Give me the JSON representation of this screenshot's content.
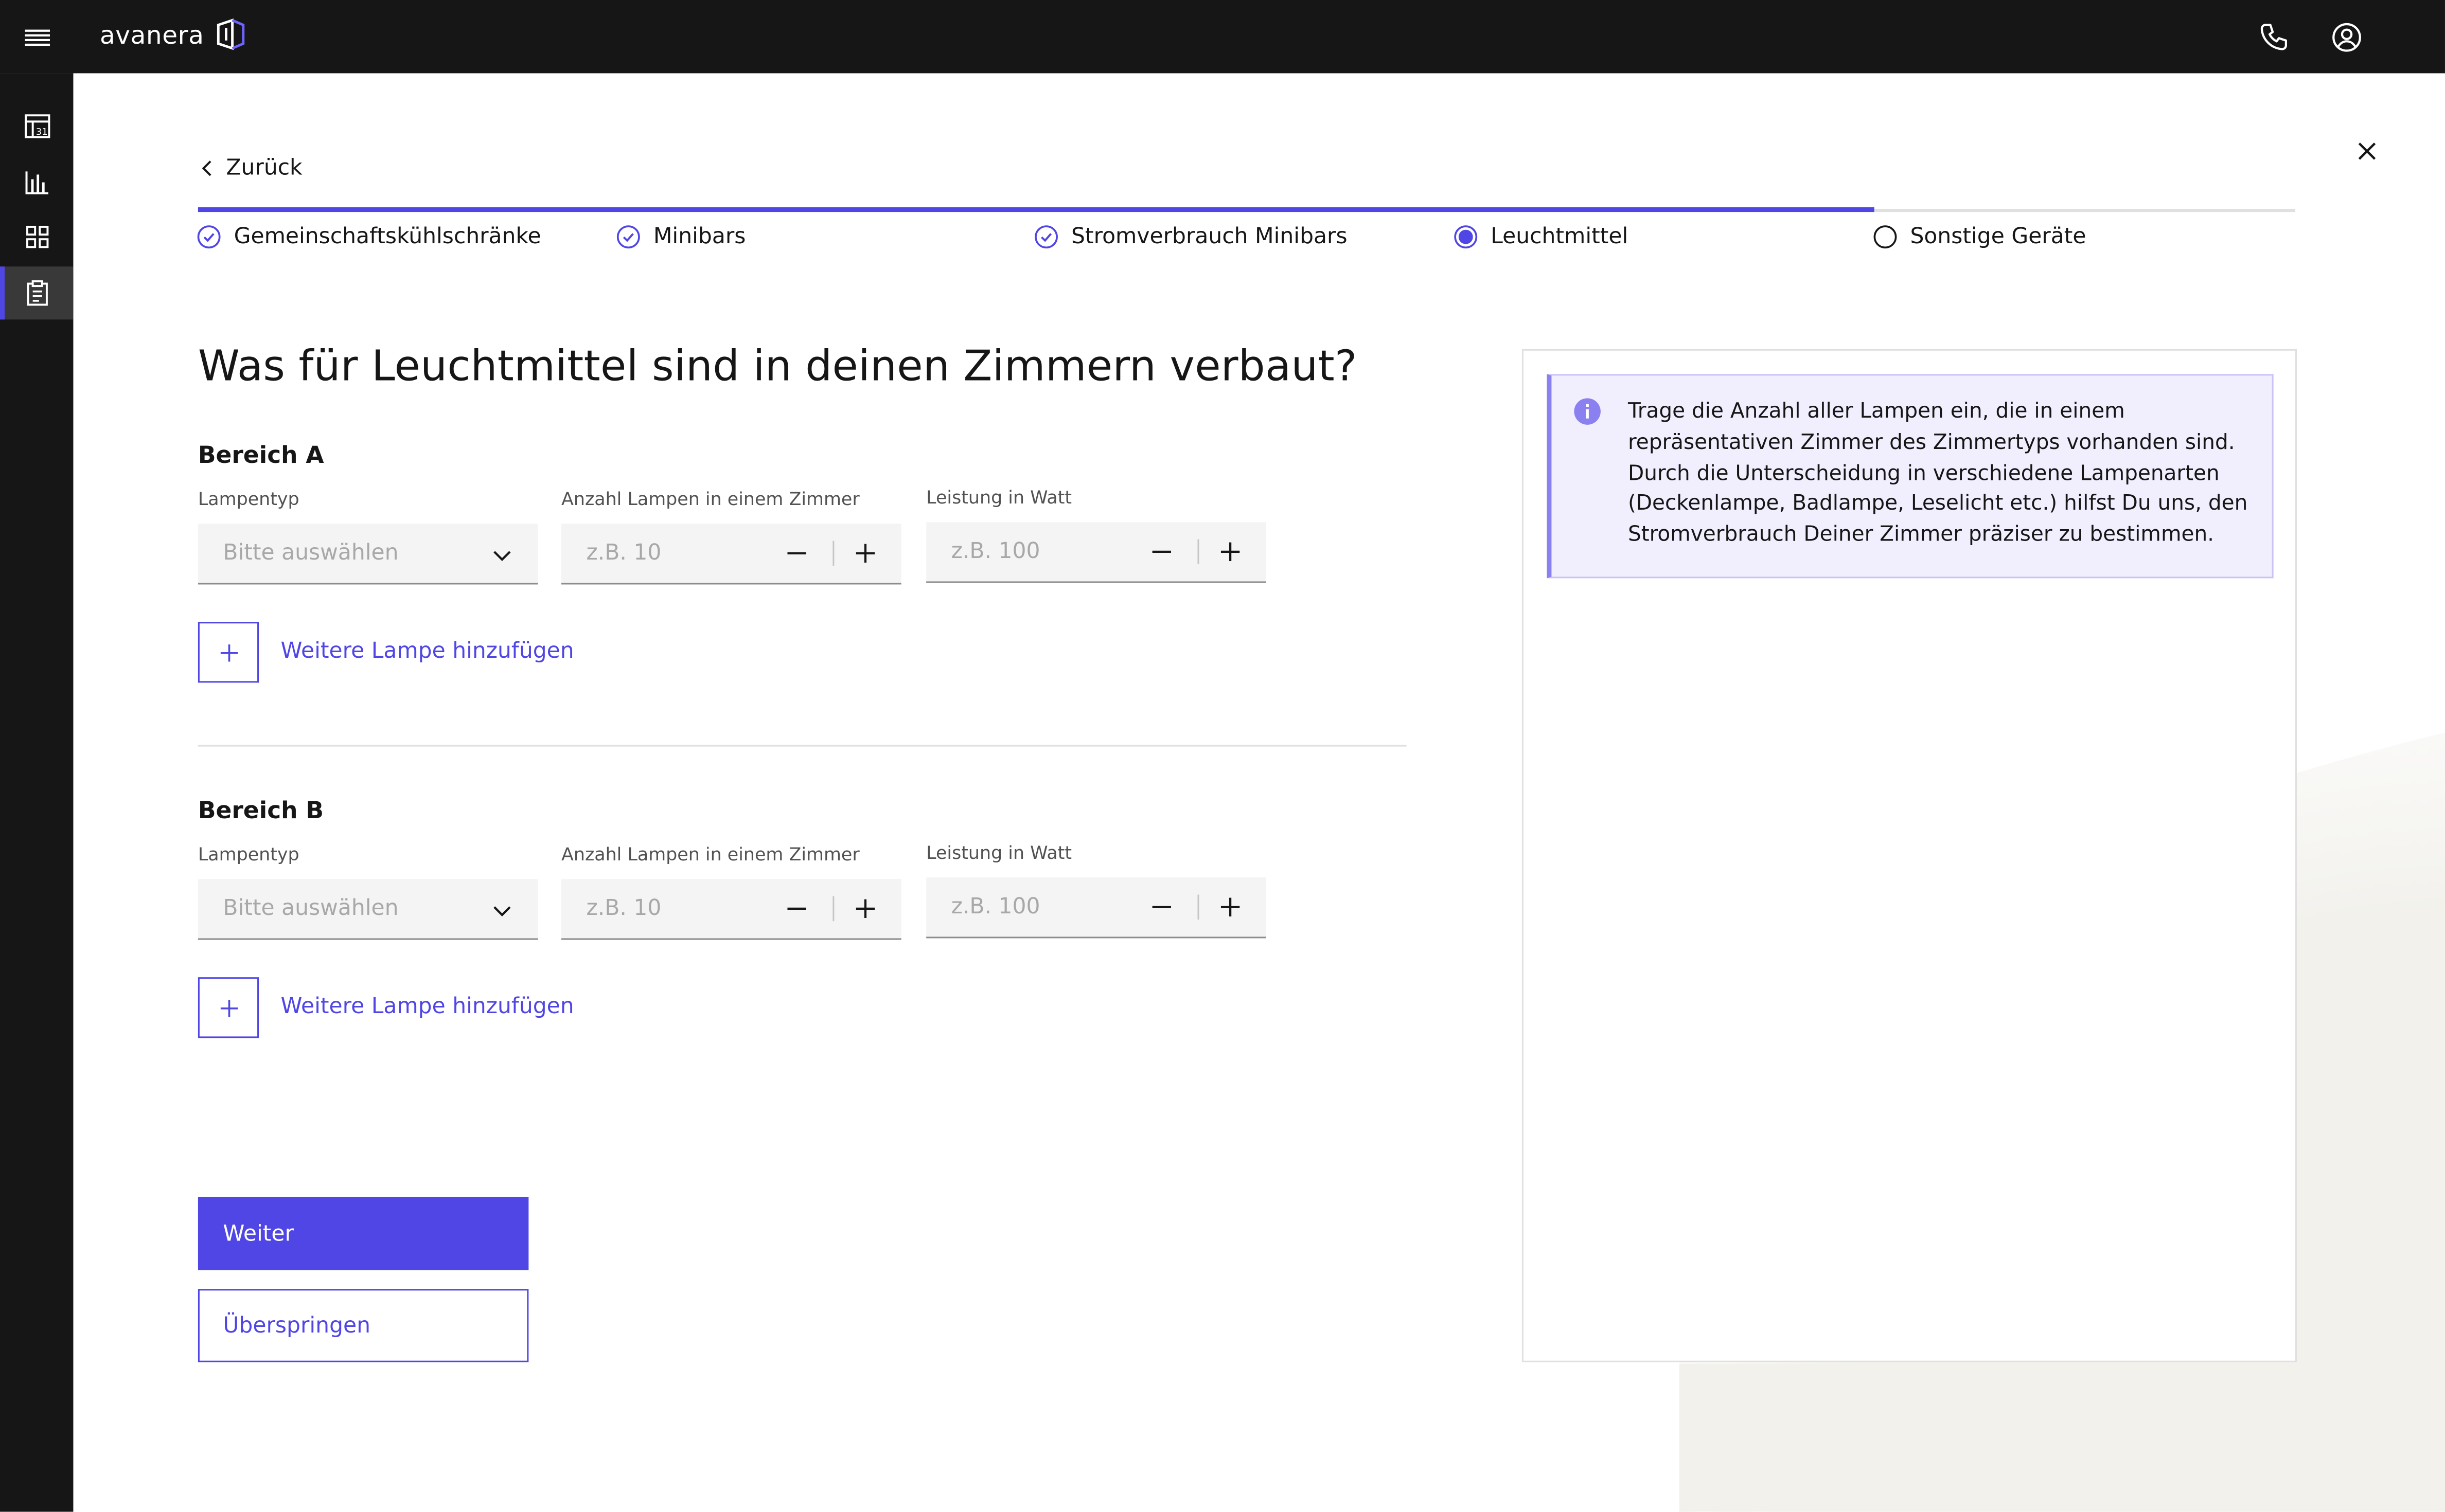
{
  "header": {
    "brand": "avanera",
    "icons": [
      "menu-icon",
      "phone-icon",
      "user-icon"
    ]
  },
  "sidebar": {
    "items": [
      {
        "icon": "calendar-icon",
        "active": false
      },
      {
        "icon": "bar-chart-icon",
        "active": false
      },
      {
        "icon": "grid-icon",
        "active": false
      },
      {
        "icon": "clipboard-icon",
        "active": true
      }
    ]
  },
  "nav": {
    "back_label": "Zurück"
  },
  "progress": {
    "fraction_complete": 0.8,
    "steps": [
      {
        "label": "Gemeinschaftskühlschränke",
        "state": "complete"
      },
      {
        "label": "Minibars",
        "state": "complete"
      },
      {
        "label": "Stromverbrauch Minibars",
        "state": "complete"
      },
      {
        "label": "Leuchtmittel",
        "state": "current"
      },
      {
        "label": "Sonstige Geräte",
        "state": "incomplete"
      }
    ]
  },
  "main": {
    "title": "Was für Leuchtmittel sind in deinen Zimmern verbaut?",
    "sections": [
      {
        "title": "Bereich A",
        "lamp_type_label": "Lampentyp",
        "lamp_type_placeholder": "Bitte auswählen",
        "count_label": "Anzahl Lampen in einem Zimmer",
        "count_placeholder": "z.B. 10",
        "power_label": "Leistung in Watt",
        "power_placeholder": "z.B. 100",
        "add_label": "Weitere Lampe hinzufügen"
      },
      {
        "title": "Bereich B",
        "lamp_type_label": "Lampentyp",
        "lamp_type_placeholder": "Bitte auswählen",
        "count_label": "Anzahl Lampen in einem Zimmer",
        "count_placeholder": "z.B. 10",
        "power_label": "Leistung in Watt",
        "power_placeholder": "z.B. 100",
        "add_label": "Weitere Lampe hinzufügen"
      }
    ],
    "primary_button": "Weiter",
    "secondary_button": "Überspringen"
  },
  "info": {
    "lines": [
      "Trage die Anzahl aller Lampen ein, die in einem",
      "repräsentativen Zimmer des Zimmertyps vorhanden sind.",
      "Durch die Unterscheidung in verschiedene Lampenarten",
      "(Deckenlampe, Badlampe, Leselicht etc.) hilfst Du uns, den",
      "Stromverbrauch Deiner Zimmer präziser zu bestimmen."
    ]
  },
  "colors": {
    "accent": "#4f46e5",
    "header_bg": "#161616",
    "field_bg": "#f4f4f4",
    "notice_bg": "#f1effe"
  }
}
